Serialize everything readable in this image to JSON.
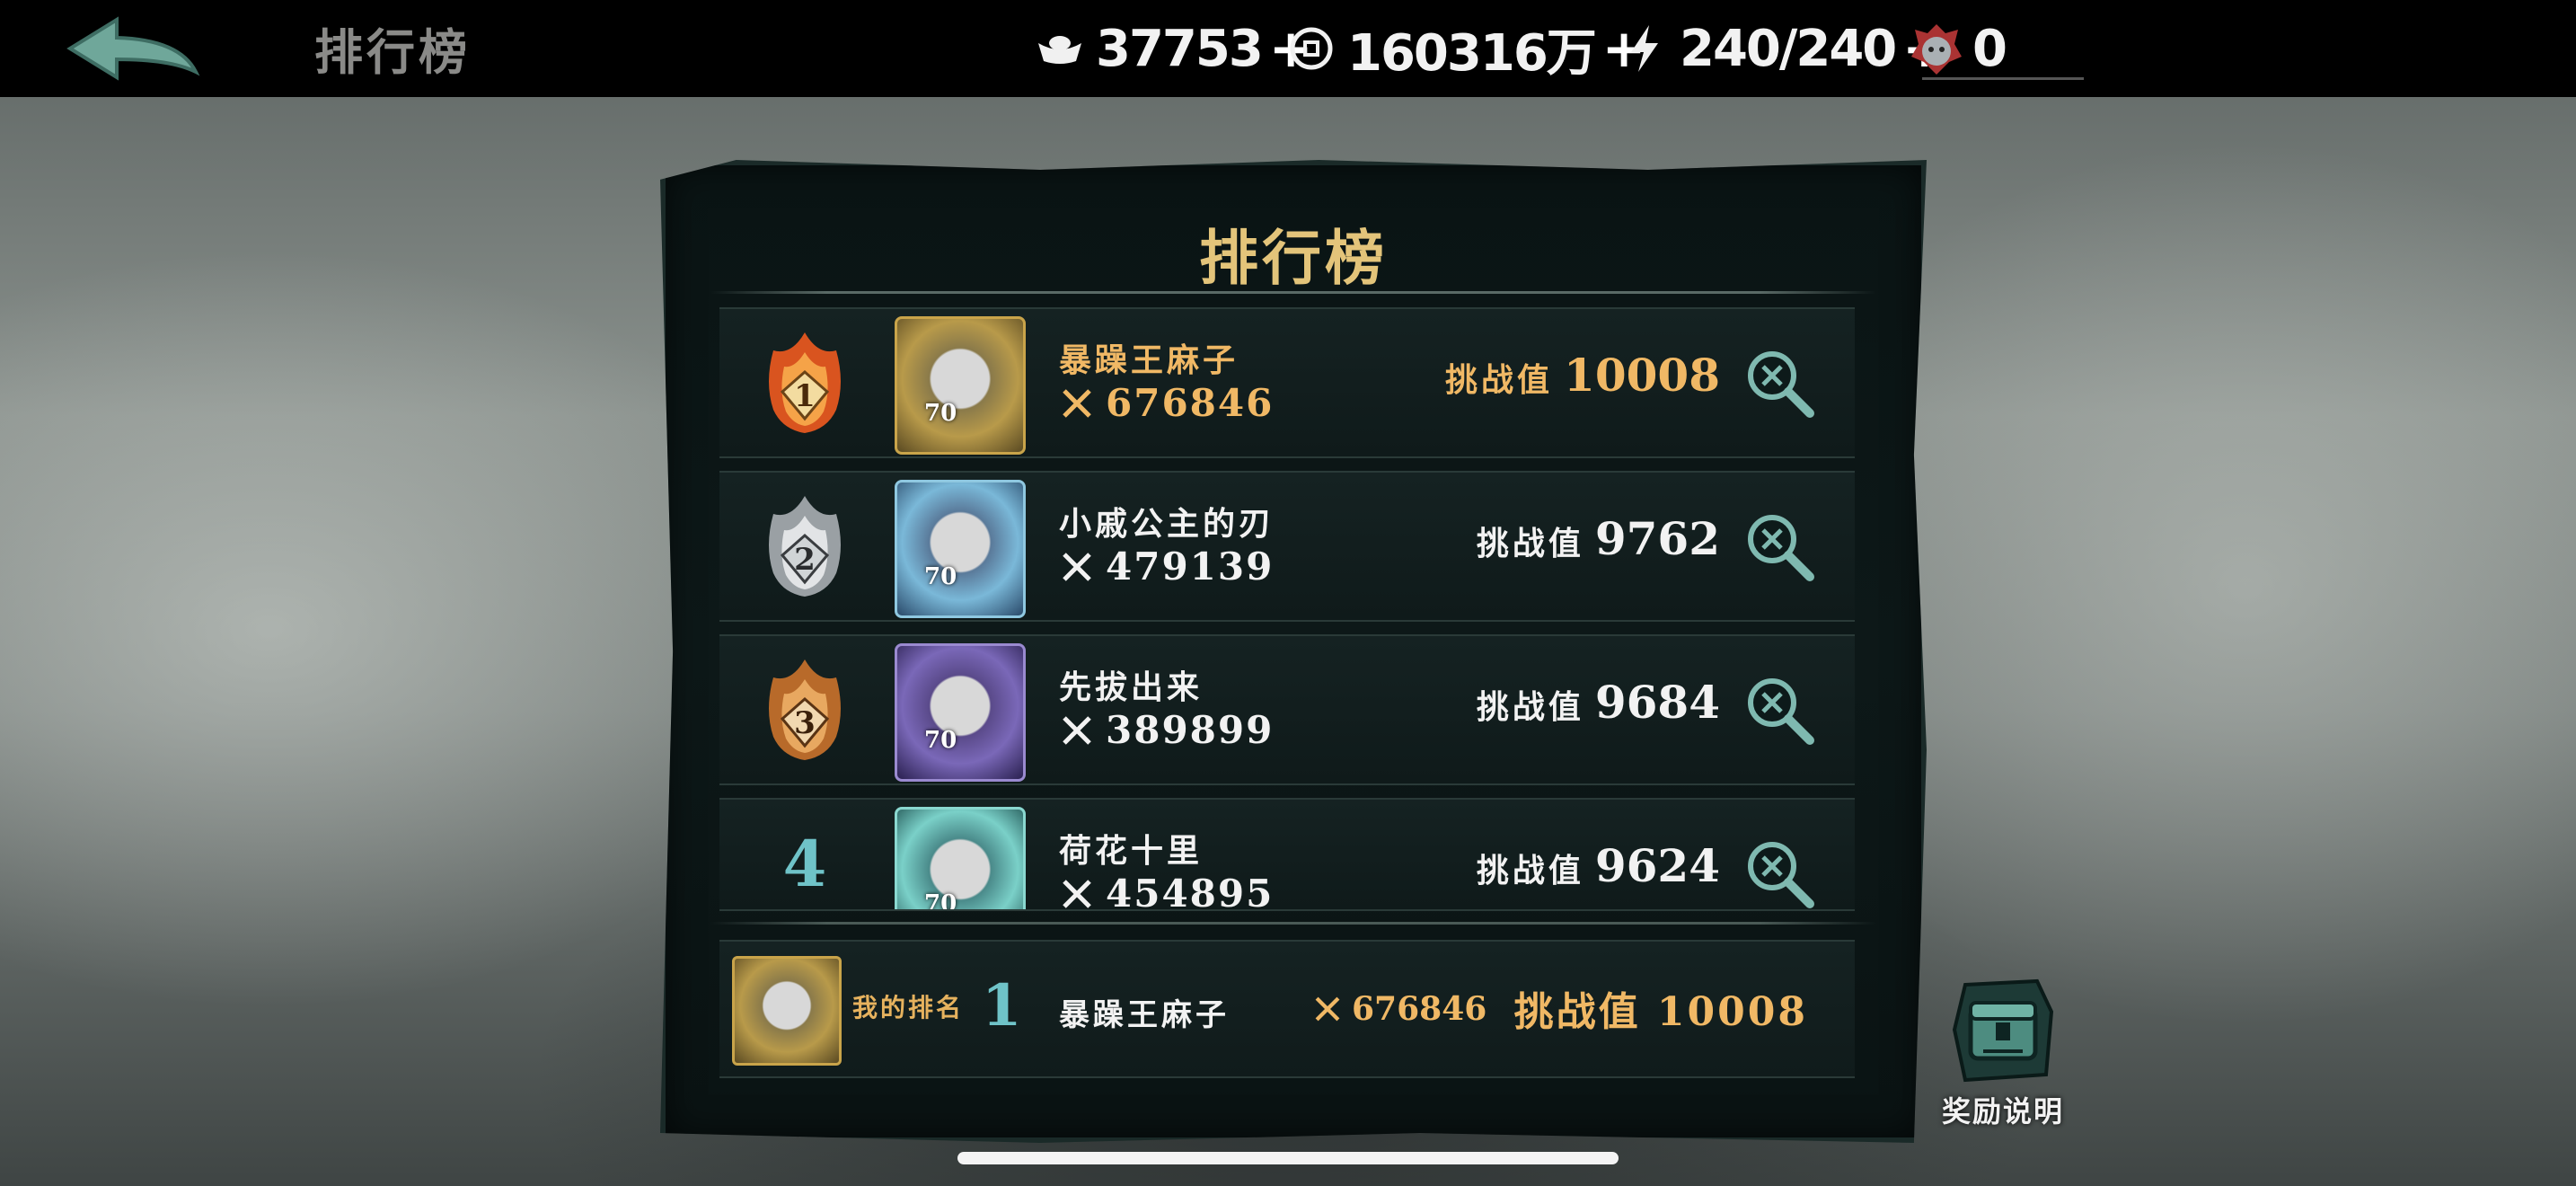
{
  "header": {
    "title": "排行榜",
    "resources": [
      {
        "icon": "silver-ingot-icon",
        "value": "37753"
      },
      {
        "icon": "coin-icon",
        "value": "160316万"
      },
      {
        "icon": "lightning-icon",
        "value": "240/240"
      },
      {
        "icon": "demon-mask-icon",
        "value": "0"
      }
    ]
  },
  "panel": {
    "title": "排行榜",
    "challenge_label": "挑战值",
    "entries": [
      {
        "rank": "1",
        "name": "暴躁王麻子",
        "power": "676846",
        "challenge": "10008",
        "level": "70",
        "style": "gold"
      },
      {
        "rank": "2",
        "name": "小戚公主的刃",
        "power": "479139",
        "challenge": "9762",
        "level": "70",
        "style": "white"
      },
      {
        "rank": "3",
        "name": "先拔出来",
        "power": "389899",
        "challenge": "9684",
        "level": "70",
        "style": "white"
      },
      {
        "rank": "4",
        "name": "荷花十里",
        "power": "454895",
        "challenge": "9624",
        "level": "70",
        "style": "white"
      }
    ],
    "my_rank": {
      "label": "我的排名",
      "rank": "1",
      "name": "暴躁王麻子",
      "power": "676846",
      "challenge_label": "挑战值",
      "challenge": "10008"
    }
  },
  "reward": {
    "label": "奖励说明",
    "icon": "treasure-chest-icon"
  },
  "colors": {
    "gold": "#f0b865",
    "teal": "#6fc3c8",
    "title_gold": "#e3c47a"
  }
}
